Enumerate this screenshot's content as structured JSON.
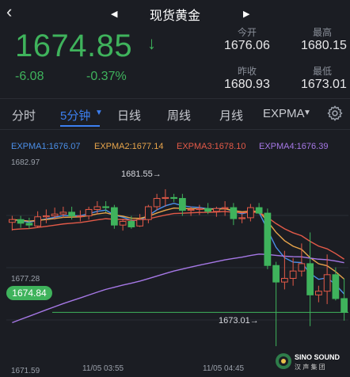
{
  "header": {
    "title": "现货黄金"
  },
  "quote": {
    "price": "1674.85",
    "direction": "↓",
    "change": "-6.08",
    "change_pct": "-0.37%",
    "open_label": "今开",
    "open": "1676.06",
    "high_label": "最高",
    "high": "1680.15",
    "prev_label": "昨收",
    "prev": "1680.93",
    "low_label": "最低",
    "low": "1673.01"
  },
  "tabs": [
    "分时",
    "5分钟",
    "日线",
    "周线",
    "月线",
    "EXPMA"
  ],
  "tab_active": "5分钟",
  "legend": [
    {
      "label": "EXPMA1:1676.07",
      "color": "#4b8fe8"
    },
    {
      "label": "EXPMA2:1677.14",
      "color": "#e8a54b"
    },
    {
      "label": "EXPMA3:1678.10",
      "color": "#e35a48"
    },
    {
      "label": "EXPMA4:1676.39",
      "color": "#a678e6"
    }
  ],
  "axis": {
    "y_top": "1682.97",
    "y_mid": "1677.28",
    "y_bottom": "1671.59",
    "current": "1674.84",
    "x1": "11/05 03:55",
    "x2": "11/05 04:45"
  },
  "annotations": {
    "high": "1681.55",
    "low": "1673.01"
  },
  "colors": {
    "up": "#e35a48",
    "down": "#3fb35c",
    "background": "#1b1d23",
    "accent": "#3c7ff0"
  },
  "chart_data": {
    "type": "candlestick",
    "ylim": [
      1671.59,
      1682.97
    ],
    "candles": [
      {
        "o": 1679.75,
        "h": 1680.1,
        "l": 1679.3,
        "c": 1679.9
      },
      {
        "o": 1679.9,
        "h": 1680.1,
        "l": 1679.45,
        "c": 1679.7
      },
      {
        "o": 1679.7,
        "h": 1680.0,
        "l": 1679.4,
        "c": 1679.6
      },
      {
        "o": 1679.55,
        "h": 1680.35,
        "l": 1679.45,
        "c": 1680.05
      },
      {
        "o": 1680.05,
        "h": 1680.45,
        "l": 1679.7,
        "c": 1680.1
      },
      {
        "o": 1680.1,
        "h": 1680.55,
        "l": 1679.9,
        "c": 1680.2
      },
      {
        "o": 1680.2,
        "h": 1680.6,
        "l": 1680.0,
        "c": 1680.3
      },
      {
        "o": 1680.3,
        "h": 1680.6,
        "l": 1679.9,
        "c": 1680.1
      },
      {
        "o": 1680.1,
        "h": 1680.4,
        "l": 1679.8,
        "c": 1680.1
      },
      {
        "o": 1680.1,
        "h": 1680.6,
        "l": 1679.9,
        "c": 1680.45
      },
      {
        "o": 1680.45,
        "h": 1680.9,
        "l": 1680.2,
        "c": 1680.6
      },
      {
        "o": 1680.6,
        "h": 1680.9,
        "l": 1680.3,
        "c": 1680.55
      },
      {
        "o": 1680.55,
        "h": 1680.7,
        "l": 1679.4,
        "c": 1679.6
      },
      {
        "o": 1679.6,
        "h": 1679.95,
        "l": 1679.3,
        "c": 1679.8
      },
      {
        "o": 1679.8,
        "h": 1680.1,
        "l": 1679.4,
        "c": 1679.5
      },
      {
        "o": 1679.55,
        "h": 1680.2,
        "l": 1679.5,
        "c": 1679.9
      },
      {
        "o": 1679.9,
        "h": 1680.7,
        "l": 1679.7,
        "c": 1680.6
      },
      {
        "o": 1680.6,
        "h": 1681.3,
        "l": 1680.4,
        "c": 1681.05
      },
      {
        "o": 1681.05,
        "h": 1681.55,
        "l": 1680.6,
        "c": 1681.1
      },
      {
        "o": 1681.1,
        "h": 1681.3,
        "l": 1680.85,
        "c": 1681.05
      },
      {
        "o": 1681.05,
        "h": 1681.3,
        "l": 1680.1,
        "c": 1680.4
      },
      {
        "o": 1680.4,
        "h": 1680.6,
        "l": 1680.1,
        "c": 1680.45
      },
      {
        "o": 1680.45,
        "h": 1680.7,
        "l": 1680.15,
        "c": 1680.5
      },
      {
        "o": 1680.5,
        "h": 1680.8,
        "l": 1680.2,
        "c": 1680.35
      },
      {
        "o": 1680.35,
        "h": 1680.6,
        "l": 1680.05,
        "c": 1680.5
      },
      {
        "o": 1680.5,
        "h": 1680.9,
        "l": 1680.1,
        "c": 1680.55
      },
      {
        "o": 1680.55,
        "h": 1680.8,
        "l": 1679.6,
        "c": 1679.95
      },
      {
        "o": 1679.95,
        "h": 1680.2,
        "l": 1679.7,
        "c": 1680.0
      },
      {
        "o": 1680.0,
        "h": 1680.75,
        "l": 1679.8,
        "c": 1680.55
      },
      {
        "o": 1680.55,
        "h": 1680.8,
        "l": 1680.2,
        "c": 1680.25
      },
      {
        "o": 1680.25,
        "h": 1680.5,
        "l": 1677.2,
        "c": 1677.4
      },
      {
        "o": 1677.4,
        "h": 1677.6,
        "l": 1673.01,
        "c": 1676.5
      },
      {
        "o": 1676.5,
        "h": 1678.2,
        "l": 1676.1,
        "c": 1676.7
      },
      {
        "o": 1676.7,
        "h": 1677.8,
        "l": 1676.3,
        "c": 1677.1
      },
      {
        "o": 1677.1,
        "h": 1678.6,
        "l": 1676.8,
        "c": 1677.5
      },
      {
        "o": 1677.5,
        "h": 1679.2,
        "l": 1674.1,
        "c": 1675.8
      },
      {
        "o": 1675.8,
        "h": 1676.3,
        "l": 1675.4,
        "c": 1676.0
      },
      {
        "o": 1676.0,
        "h": 1678.0,
        "l": 1675.3,
        "c": 1676.9
      },
      {
        "o": 1676.9,
        "h": 1677.3,
        "l": 1675.5,
        "c": 1675.6
      },
      {
        "o": 1675.6,
        "h": 1676.7,
        "l": 1674.4,
        "c": 1674.85
      }
    ]
  }
}
